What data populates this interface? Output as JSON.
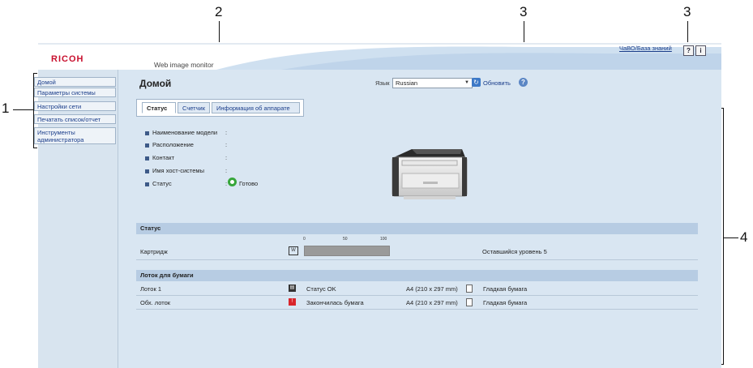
{
  "callouts": [
    "1",
    "2",
    "3",
    "3",
    "4"
  ],
  "header": {
    "brand": "RICOH",
    "product": "Web image monitor",
    "faq_link": "ЧаВО/База знаний",
    "help_icon": "?",
    "info_icon": "i"
  },
  "sidebar": {
    "items": [
      {
        "label": "Домой"
      },
      {
        "label": "Параметры системы"
      },
      {
        "label": "Настройки сети"
      },
      {
        "label": "Печатать список/отчет"
      },
      {
        "label": "Инструменты администратора"
      }
    ]
  },
  "main": {
    "title": "Домой",
    "language_label": "Язык",
    "language_value": "Russian",
    "refresh_label": "Обновить",
    "help_icon": "?",
    "tabs": [
      {
        "label": "Статус",
        "active": true
      },
      {
        "label": "Счетчик",
        "active": false
      },
      {
        "label": "Информация об аппарате",
        "active": false
      }
    ],
    "info": [
      {
        "label": "Наименование модели",
        "value": ""
      },
      {
        "label": "Расположение",
        "value": ""
      },
      {
        "label": "Контакт",
        "value": ""
      },
      {
        "label": "Имя хост-системы",
        "value": ""
      },
      {
        "label": "Статус",
        "value": "Готово"
      }
    ],
    "colon": ":",
    "status_section": {
      "title": "Статус",
      "cartridge_label": "Картридж",
      "scale": [
        "0",
        "50",
        "100"
      ],
      "toner_level_percent": 100,
      "remaining_label": "Оставшийся уровень 5"
    },
    "trays_section": {
      "title": "Лоток для бумаги",
      "rows": [
        {
          "name": "Лоток 1",
          "status": "Статус OK",
          "size": "A4 (210 x 297 mm)",
          "type": "Гладкая бумага",
          "status_color": "#333333"
        },
        {
          "name": "Обх. лоток",
          "status": "Закончилась бумага",
          "size": "A4 (210 x 297 mm)",
          "type": "Гладкая бумага",
          "status_color": "#d9262c"
        }
      ]
    }
  },
  "colors": {
    "brand": "#c8102e",
    "link": "#1a3d8a",
    "panel": "#d9e6f2",
    "section_bar": "#b7cce3",
    "ok_green": "#37a63b"
  }
}
